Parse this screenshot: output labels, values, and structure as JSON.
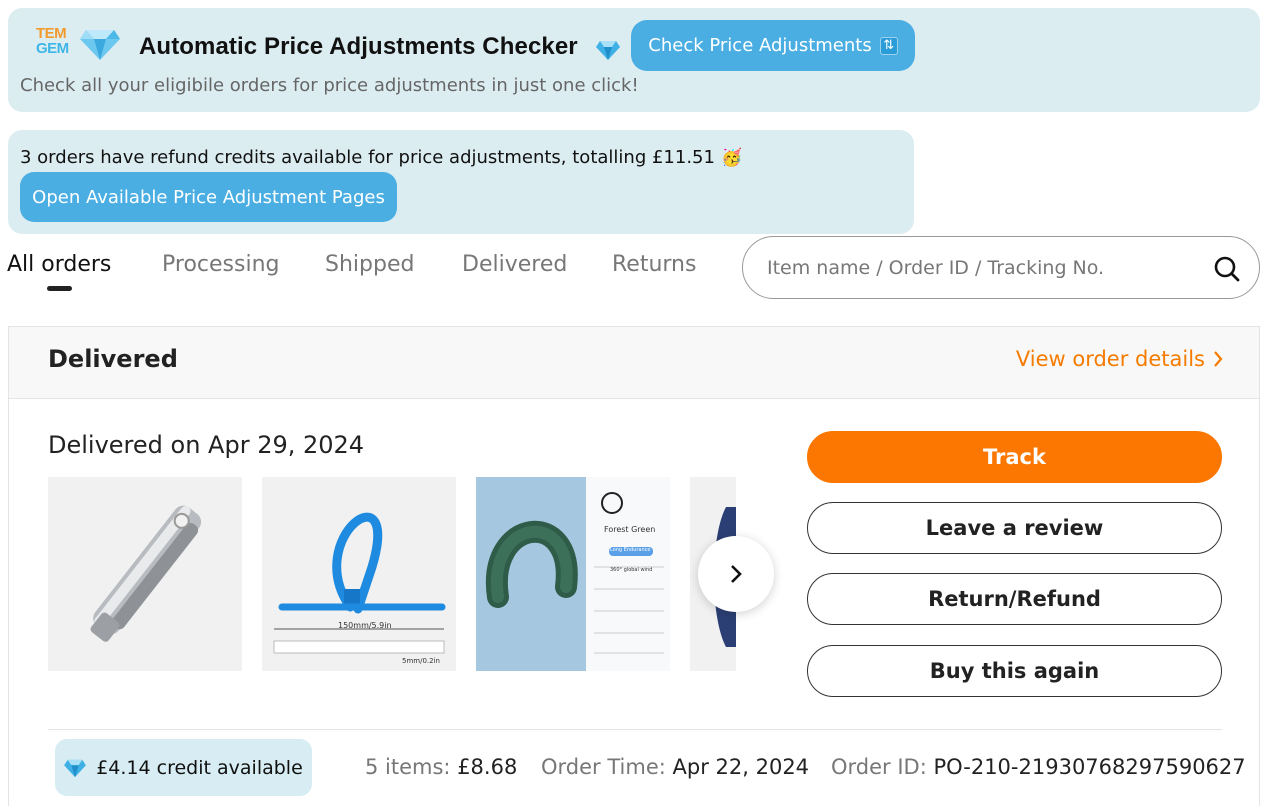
{
  "extension": {
    "logo": {
      "line1": "TEM",
      "line2": "GEM"
    },
    "title": "Automatic Price Adjustments Checker",
    "check_button": "Check Price Adjustments",
    "subtitle": "Check all your eligibile orders for price adjustments in just one click!",
    "refund_message": "3 orders have refund credits available for price adjustments, totalling £11.51",
    "refund_emoji": "🥳",
    "open_button": "Open Available Price Adjustment Pages",
    "colors": {
      "banner_bg": "#dcedf1",
      "button_bg": "#4aaee3"
    }
  },
  "tabs": [
    {
      "label": "All orders",
      "active": true
    },
    {
      "label": "Processing",
      "active": false
    },
    {
      "label": "Shipped",
      "active": false
    },
    {
      "label": "Delivered",
      "active": false
    },
    {
      "label": "Returns",
      "active": false
    }
  ],
  "search": {
    "placeholder": "Item name / Order ID / Tracking No.",
    "icon": "search-icon"
  },
  "order": {
    "status": "Delivered",
    "view_details": "View order details",
    "delivered_on": "Delivered on Apr 29, 2024",
    "thumbnails": [
      {
        "name": "nail-clipper"
      },
      {
        "name": "blue-cable-tie",
        "dim_length": "150mm/5.9in",
        "dim_width": "5mm/0.2in"
      },
      {
        "name": "neck-fan",
        "color_label": "Forest Green",
        "badge": "Long Endurance",
        "features": [
          "360° global wind",
          "",
          "",
          "",
          ""
        ]
      },
      {
        "name": "partial-item"
      }
    ],
    "actions": {
      "track": "Track",
      "review": "Leave a review",
      "return": "Return/Refund",
      "buy_again": "Buy this again"
    },
    "credit": "£4.14 credit available",
    "items_label": "5 items:",
    "items_value": "£8.68",
    "order_time_label": "Order Time:",
    "order_time_value": "Apr 22, 2024",
    "order_id_label": "Order ID:",
    "order_id_value": "PO-210-21930768297590627",
    "colors": {
      "accent": "#fb7701",
      "link": "#f57c00"
    }
  }
}
